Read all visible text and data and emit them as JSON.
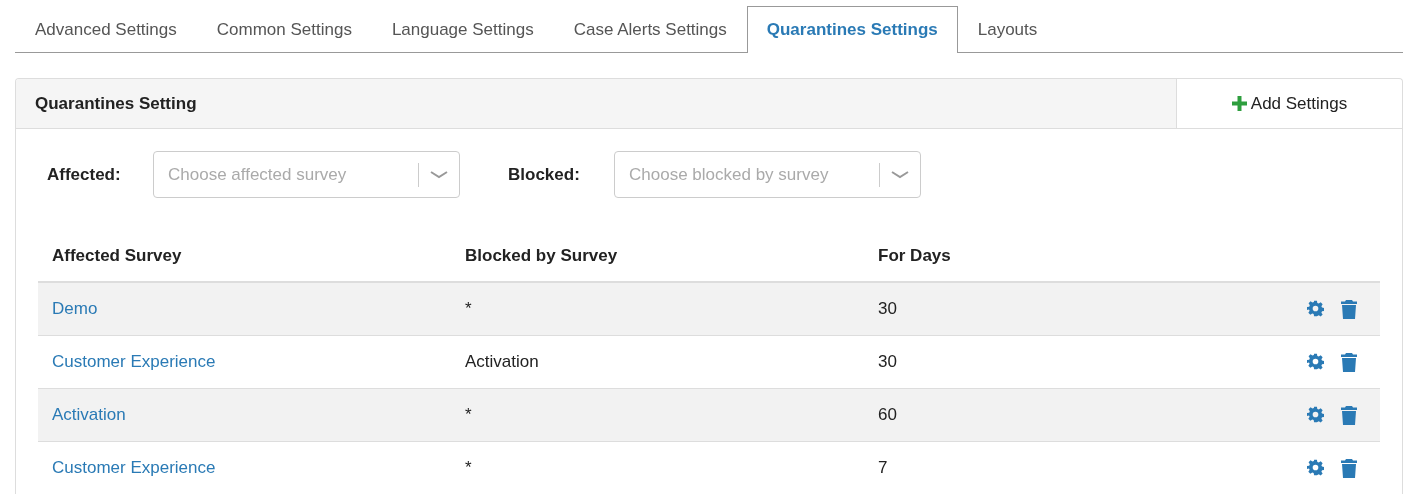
{
  "tabs": [
    {
      "label": "Advanced Settings",
      "selected": false
    },
    {
      "label": "Common Settings",
      "selected": false
    },
    {
      "label": "Language Settings",
      "selected": false
    },
    {
      "label": "Case Alerts Settings",
      "selected": false
    },
    {
      "label": "Quarantines Settings",
      "selected": true
    },
    {
      "label": "Layouts",
      "selected": false
    }
  ],
  "panel": {
    "title": "Quarantines Setting",
    "add_button": "Add Settings"
  },
  "filters": [
    {
      "label": "Affected:",
      "placeholder": "Choose affected survey"
    },
    {
      "label": "Blocked:",
      "placeholder": "Choose blocked by survey"
    }
  ],
  "table": {
    "columns": [
      "Affected Survey",
      "Blocked by Survey",
      "For Days"
    ],
    "rows": [
      {
        "affected": "Demo",
        "blocked": "*",
        "days": "30"
      },
      {
        "affected": "Customer Experience",
        "blocked": "Activation",
        "days": "30"
      },
      {
        "affected": "Activation",
        "blocked": "*",
        "days": "60"
      },
      {
        "affected": "Customer Experience",
        "blocked": "*",
        "days": "7"
      }
    ]
  }
}
